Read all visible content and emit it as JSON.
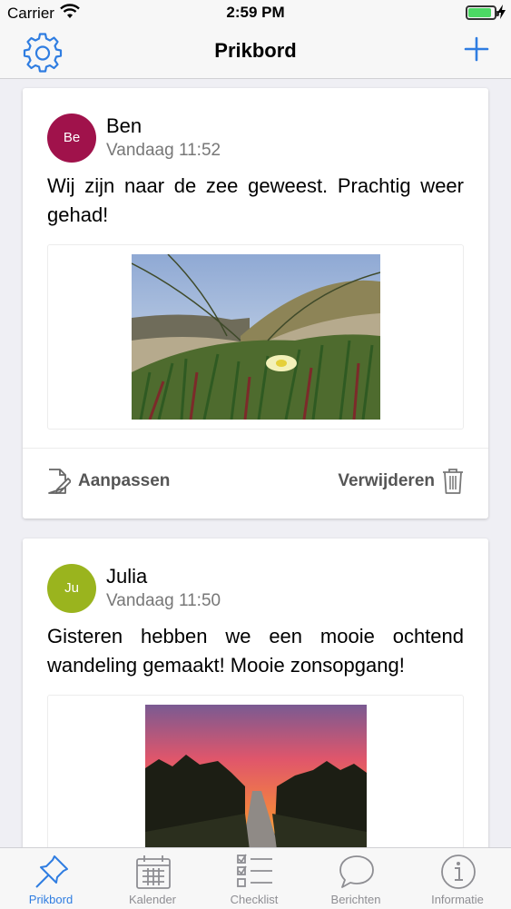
{
  "status_bar": {
    "carrier": "Carrier",
    "time": "2:59 PM",
    "battery_level": 0.9
  },
  "nav": {
    "title": "Prikbord",
    "left_icon": "gear-icon",
    "right_icon": "plus-icon"
  },
  "posts": [
    {
      "avatar_initials": "Be",
      "avatar_color": "#a0124b",
      "author": "Ben",
      "time": "Vandaag 11:52",
      "text": "Wij zijn naar de zee geweest. Prachtig weer gehad!",
      "image": "dune-flower-photo",
      "edit_label": "Aanpassen",
      "delete_label": "Verwijderen"
    },
    {
      "avatar_initials": "Ju",
      "avatar_color": "#9ab41e",
      "author": "Julia",
      "time": "Vandaag 11:50",
      "text": "Gisteren hebben we een mooie ochtend wandeling gemaakt! Mooie zonsopgang!",
      "image": "sunrise-path-photo"
    }
  ],
  "tabs": [
    {
      "label": "Prikbord",
      "icon": "pin-icon",
      "active": true
    },
    {
      "label": "Kalender",
      "icon": "calendar-icon",
      "active": false
    },
    {
      "label": "Checklist",
      "icon": "checklist-icon",
      "active": false
    },
    {
      "label": "Berichten",
      "icon": "speech-bubble-icon",
      "active": false
    },
    {
      "label": "Informatie",
      "icon": "info-icon",
      "active": false
    }
  ],
  "colors": {
    "accent": "#2f7de1",
    "tab_inactive": "#8e8e93",
    "background": "#efeff4"
  }
}
